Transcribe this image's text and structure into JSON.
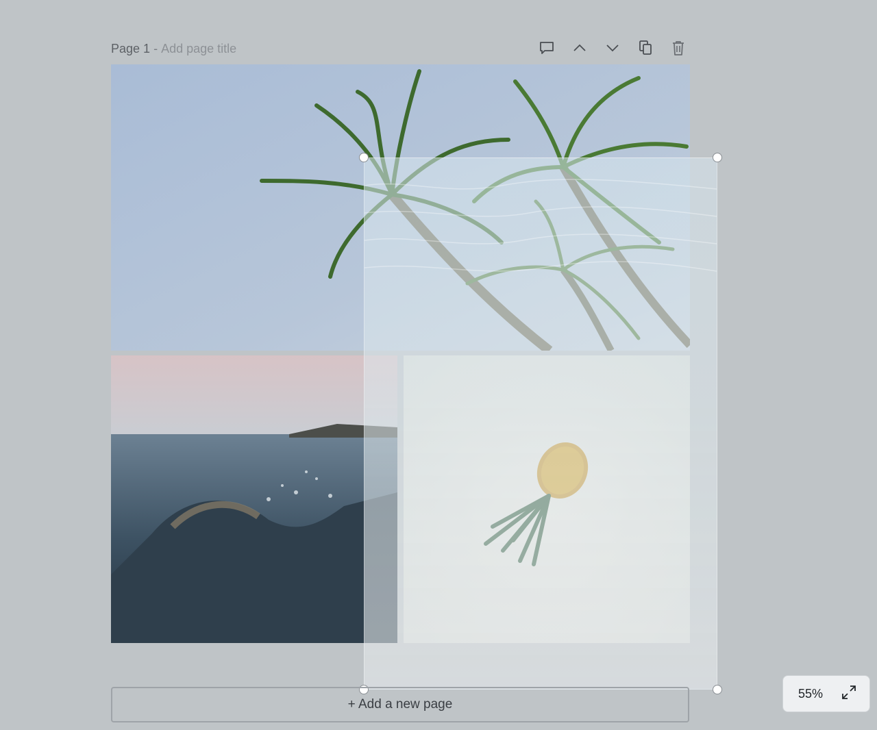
{
  "page_header": {
    "page_number": "Page 1",
    "separator": " - ",
    "title_placeholder": "Add page title"
  },
  "toolbar": {
    "icons": [
      "comment-icon",
      "chevron-up-icon",
      "chevron-down-icon",
      "duplicate-icon",
      "trash-icon"
    ]
  },
  "canvas": {
    "images": [
      "palm-trees-photo",
      "ocean-wave-photo",
      "pineapple-on-sand-photo",
      "water-surface-photo"
    ]
  },
  "add_page": {
    "label": "+ Add a new page"
  },
  "zoom": {
    "level": "55%",
    "fullscreen_icon": "expand-icon"
  },
  "colors": {
    "workspace_bg": "#bfc4c7",
    "handle": "#ffffff"
  }
}
